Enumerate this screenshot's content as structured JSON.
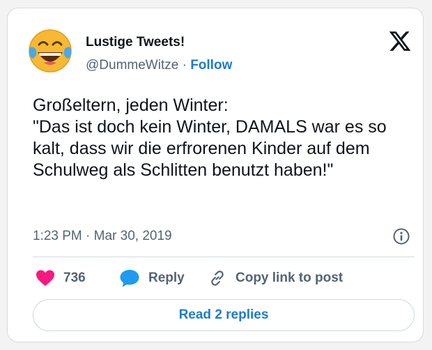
{
  "author": {
    "display_name": "Lustige Tweets!",
    "handle": "@DummeWitze",
    "separator": "·",
    "follow_label": "Follow",
    "avatar_icon": "laughing-tears-emoji-icon"
  },
  "platform_icon": "x-logo-icon",
  "tweet": {
    "text": "Großeltern, jeden Winter:\n\"Das ist doch kein Winter, DAMALS war es so kalt, dass wir die erfrorenen Kinder auf dem Schulweg als Schlitten benutzt haben!\"",
    "timestamp": "1:23 PM · Mar 30, 2019",
    "info_icon": "info-icon"
  },
  "actions": {
    "like_count": "736",
    "like_icon": "heart-icon",
    "reply_label": "Reply",
    "reply_icon": "speech-bubble-icon",
    "copy_label": "Copy link to post",
    "copy_icon": "link-icon"
  },
  "footer": {
    "read_replies_label": "Read 2 replies"
  },
  "colors": {
    "accent": "#1d7bd3",
    "heart": "#f91880",
    "text": "#0f1419",
    "secondary": "#536471",
    "border": "#cfd9de"
  }
}
